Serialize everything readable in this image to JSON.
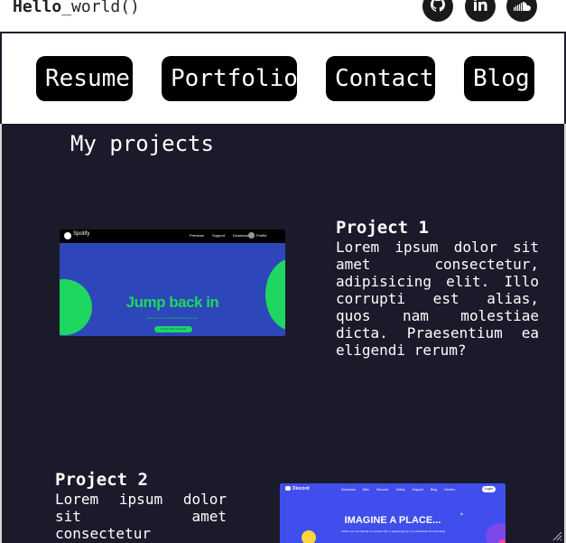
{
  "header": {
    "logo_bold": "Hello",
    "logo_rest": "_world()",
    "social": [
      {
        "icon": "github-icon"
      },
      {
        "icon": "linkedin-icon"
      },
      {
        "icon": "soundcloud-icon"
      }
    ]
  },
  "nav": {
    "items": [
      {
        "label": "Resume"
      },
      {
        "label": "Portfolio"
      },
      {
        "label": "Contact"
      },
      {
        "label": "Blog"
      }
    ]
  },
  "main": {
    "title": "My projects",
    "projects": [
      {
        "title": "Project 1",
        "description": "Lorem ipsum dolor sit amet consectetur, adipisicing elit. Illo corrupti est alias, quos nam molestiae dicta. Praesentium ea eligendi rerum?",
        "preview": {
          "brand": "Spotify",
          "nav": [
            "Premium",
            "Support",
            "Download"
          ],
          "profile": "Profile",
          "headline": "Jump back in",
          "subtext": "Pick up your music right where you left off.",
          "cta": "OPEN WEB PLAYER",
          "colors": {
            "bg": "#2d46b9",
            "accent": "#1ed760",
            "headline": "#1ed760",
            "topbar": "#000000"
          }
        }
      },
      {
        "title": "Project 2",
        "description": "Lorem ipsum dolor sit amet consectetur",
        "preview": {
          "brand": "Discord",
          "nav": [
            "Download",
            "Nitro",
            "Discover",
            "Safety",
            "Support",
            "Blog",
            "Careers"
          ],
          "login": "Login",
          "headline": "IMAGINE A PLACE...",
          "subtext": "...where you can belong to a school club, a gaming group, or a worldwide art community.",
          "colors": {
            "bg": "#404eed",
            "headline": "#ffffff"
          }
        }
      }
    ]
  }
}
